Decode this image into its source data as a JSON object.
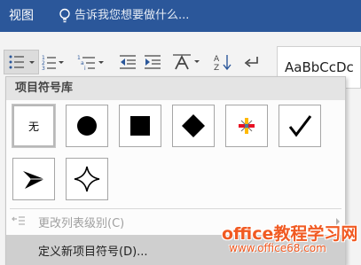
{
  "title_bar": {
    "tab_label": "视图",
    "tell_me_placeholder": "告诉我您想要做什么...",
    "background_color": "#2b579a"
  },
  "ribbon": {
    "style_preview": "AaBbCcDc",
    "icons": [
      "bullets-icon",
      "numbering-icon",
      "multilevel-list-icon",
      "decrease-indent-icon",
      "increase-indent-icon",
      "asian-layout-icon",
      "sort-icon",
      "show-formatting-icon"
    ]
  },
  "bullet_library": {
    "header": "项目符号库",
    "none_label": "无",
    "bullets": [
      "none",
      "filled-circle-icon",
      "filled-square-icon",
      "filled-diamond-icon",
      "colored-star-cross-icon",
      "checkmark-icon",
      "arrowhead-icon",
      "four-point-star-icon"
    ]
  },
  "menu": {
    "change_list_level": "更改列表级别(C)",
    "define_new_bullet": "定义新项目符号(D)..."
  },
  "watermark": {
    "title": "office教程学习网",
    "url": "www.office68.com"
  },
  "colors": {
    "accent": "#2b579a",
    "watermark": "#f15a22",
    "hover": "#cfcfcf"
  }
}
